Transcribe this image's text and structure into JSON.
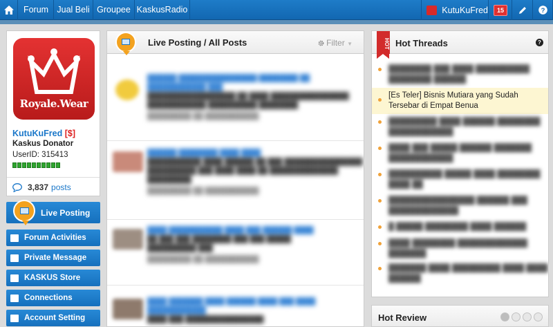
{
  "topbar": {
    "nav": [
      "Forum",
      "Jual Beli",
      "Groupee",
      "KaskusRadio"
    ],
    "username": "KutuKuFred",
    "notification_count": "15"
  },
  "profile": {
    "logo_text": "Royale.Wear",
    "username": "KutuKuFred",
    "badge": "[$]",
    "rank": "Kaskus Donator",
    "user_id": "UserID: 315413",
    "reputation_boxes": 10,
    "post_count": "3,837",
    "post_label": "posts"
  },
  "sidebar": {
    "live_posting": "Live Posting",
    "items": [
      "Forum Activities",
      "Private Message",
      "KASKUS Store",
      "Connections",
      "Account Setting"
    ]
  },
  "main": {
    "title": "Live Posting / All Posts",
    "filter": "Filter"
  },
  "hot_threads": {
    "title": "Hot Threads",
    "help": "?",
    "active_item": "[Es Teler] Bisnis Mutiara yang Sudah Tersebar di Empat Benua"
  },
  "hot_review": {
    "title": "Hot Review"
  },
  "colors": {
    "brand_blue": "#1a77c9",
    "accent_orange": "#f3a21f",
    "hot_red": "#d22b2b"
  }
}
